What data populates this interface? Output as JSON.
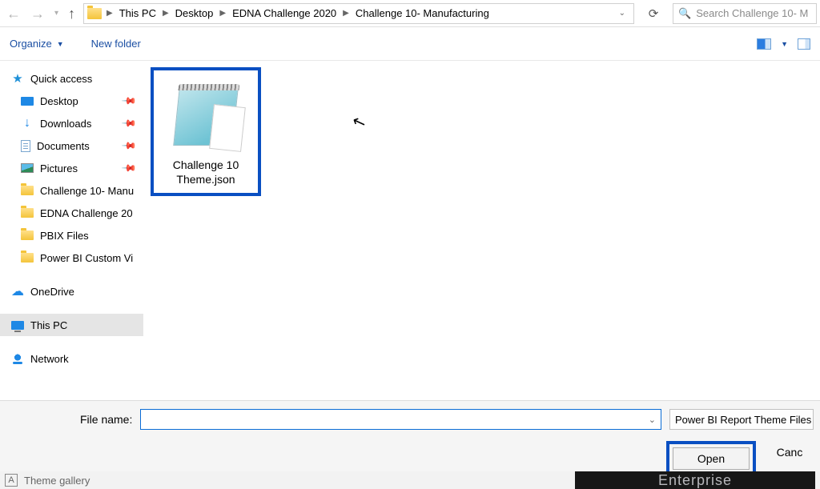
{
  "breadcrumb": {
    "items": [
      "This PC",
      "Desktop",
      "EDNA Challenge 2020",
      "Challenge 10- Manufacturing"
    ]
  },
  "search": {
    "placeholder": "Search Challenge 10- M"
  },
  "toolbar": {
    "organize": "Organize",
    "newfolder": "New folder",
    "change_view_icon": "change-view-icon",
    "options_icon": "options-icon"
  },
  "sidebar": {
    "quick_access": "Quick access",
    "pinned": [
      {
        "label": "Desktop",
        "icon": "desktop"
      },
      {
        "label": "Downloads",
        "icon": "downloads"
      },
      {
        "label": "Documents",
        "icon": "doc"
      },
      {
        "label": "Pictures",
        "icon": "pic"
      }
    ],
    "recent_folders": [
      {
        "label": "Challenge 10- Manu"
      },
      {
        "label": "EDNA Challenge 20"
      },
      {
        "label": "PBIX Files"
      },
      {
        "label": "Power BI Custom Vi"
      }
    ],
    "onedrive": "OneDrive",
    "this_pc": "This PC",
    "network": "Network"
  },
  "file": {
    "name": "Challenge 10 Theme.json"
  },
  "footer": {
    "label": "File name:",
    "value": "",
    "filter": "Power BI Report Theme Files",
    "open": "Open",
    "cancel": "Canc"
  },
  "bottom": {
    "theme_gallery": "Theme gallery",
    "watermark": "Enterprise"
  }
}
